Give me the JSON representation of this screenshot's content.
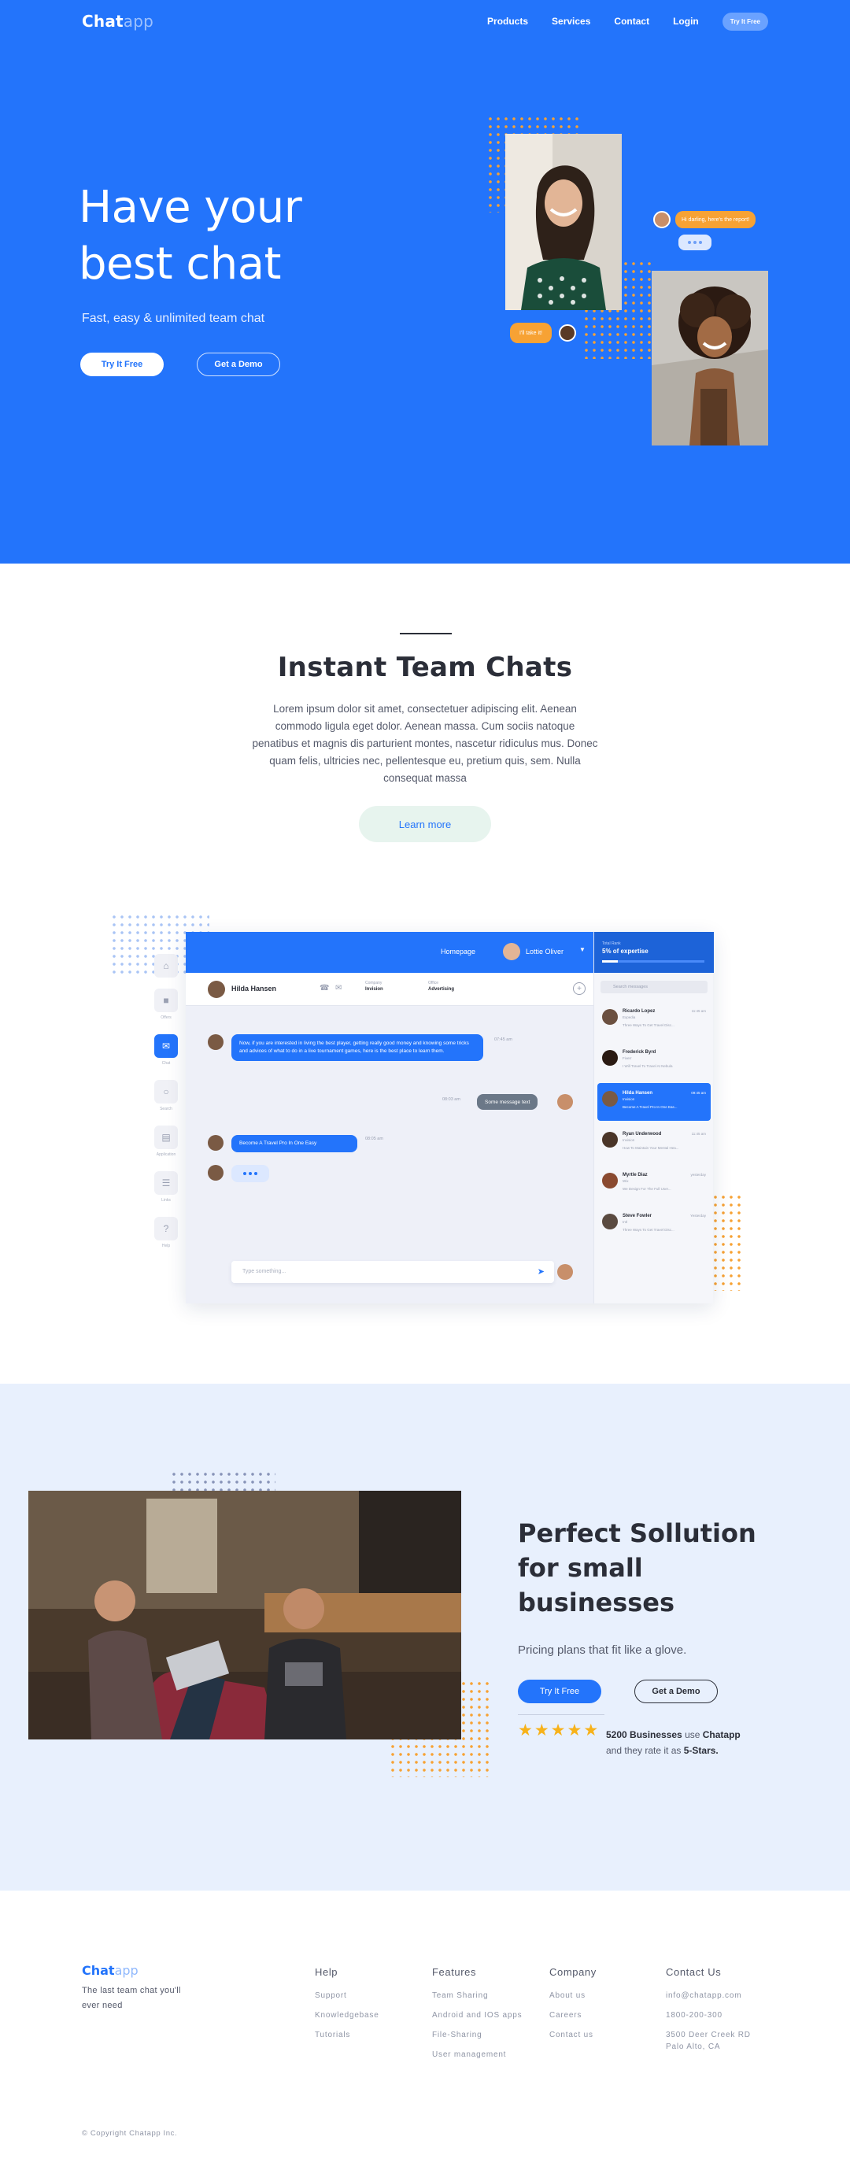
{
  "nav": {
    "logo_main": "Chat",
    "logo_light": "app",
    "links": [
      "Products",
      "Services",
      "Contact",
      "Login"
    ],
    "cta": "Try It Free"
  },
  "hero": {
    "title_line1": "Have your",
    "title_line2": "best chat",
    "subtitle": "Fast, easy & unlimited team chat",
    "btn_primary": "Try It Free",
    "btn_secondary": "Get a Demo",
    "bubble_right": "Hi darling, here's the report!",
    "bubble_left": "I'll take it!"
  },
  "chats_section": {
    "title": "Instant Team Chats",
    "body": "Lorem ipsum dolor sit amet, consectetuer adipiscing elit. Aenean commodo ligula eget dolor. Aenean massa. Cum sociis natoque penatibus et magnis dis parturient montes, nascetur ridiculus mus. Donec quam felis, ultricies nec, pellentesque eu, pretium quis, sem. Nulla consequat massa",
    "cta": "Learn more"
  },
  "app_mock": {
    "top_link": "Homepage",
    "user_name": "Lottie Oliver",
    "conversation_name": "Hilda Hansen",
    "company_label": "Company",
    "company_value": "Invision",
    "office_label": "Office",
    "office_value": "Advertising",
    "messages": [
      {
        "text": "Now, if you are interested in living the best player, getting really good money and knowing some tricks and advices of what to do in a live tournament games, here is the best place to learn them.",
        "time": "07:45 am"
      },
      {
        "text": "Some message text",
        "time": "08:03 am"
      },
      {
        "text": "Become A Travel Pro In One Easy",
        "time": "08:05 am"
      }
    ],
    "input_placeholder": "Type something...",
    "rail": [
      "Offers",
      "Chat",
      "Search",
      "Application",
      "Links",
      "Help"
    ],
    "side_top_small": "Total Rank",
    "side_top_title": "5% of expertise",
    "search_placeholder": "Search messages",
    "contacts": [
      {
        "name": "Ricardo Lopez",
        "role": "Expedia",
        "msg": "Three Ways To Get Travel Disc...",
        "time": "11:45 am"
      },
      {
        "name": "Frederick Byrd",
        "role": "Fiverr",
        "msg": "I Will Travel To Travel At Nebula",
        "time": ""
      },
      {
        "name": "Hilda Hansen",
        "role": "Invision",
        "msg": "Become A Travel Pro In One Eas...",
        "time": "09:45 am"
      },
      {
        "name": "Ryan Underwood",
        "role": "Invision",
        "msg": "How To Maintain Your Mental Hea...",
        "time": "11:45 am"
      },
      {
        "name": "Myrtle Diaz",
        "role": "Wix",
        "msg": "We Design For The Full User...",
        "time": "yesterday"
      },
      {
        "name": "Steve Fowler",
        "role": "Intl",
        "msg": "Three Ways To Get Travel Disc...",
        "time": "Yesterday"
      }
    ]
  },
  "perfect": {
    "title_line1": "Perfect Sollution",
    "title_line2": "for small",
    "title_line3": "businesses",
    "subtitle": "Pricing plans that fit like a glove.",
    "btn_primary": "Try It Free",
    "btn_secondary": "Get a Demo",
    "stars": 5,
    "rating_count": "5200 Businesses",
    "rating_mid": " use ",
    "rating_brand": "Chatapp",
    "rating_line2_a": "and they rate it as ",
    "rating_line2_b": "5-Stars."
  },
  "footer": {
    "logo_main": "Chat",
    "logo_light": "app",
    "tagline": "The last team chat you'll ever need",
    "cols": [
      {
        "heading": "Help",
        "links": [
          "Support",
          "Knowledgebase",
          "Tutorials"
        ]
      },
      {
        "heading": "Features",
        "links": [
          "Team Sharing",
          "Android and IOS apps",
          "File-Sharing",
          "User management"
        ]
      },
      {
        "heading": "Company",
        "links": [
          "About us",
          "Careers",
          "Contact us"
        ]
      },
      {
        "heading": "Contact Us",
        "links": [
          "info@chatapp.com",
          "1800-200-300",
          "3500 Deer Creek RD",
          "Palo Alto, CA"
        ]
      }
    ],
    "copyright": "© Copyright Chatapp Inc."
  },
  "colors": {
    "primary": "#2374fb",
    "accent_orange": "#f7a234",
    "star": "#f7b21a",
    "section_tint": "#e8f0fd"
  }
}
